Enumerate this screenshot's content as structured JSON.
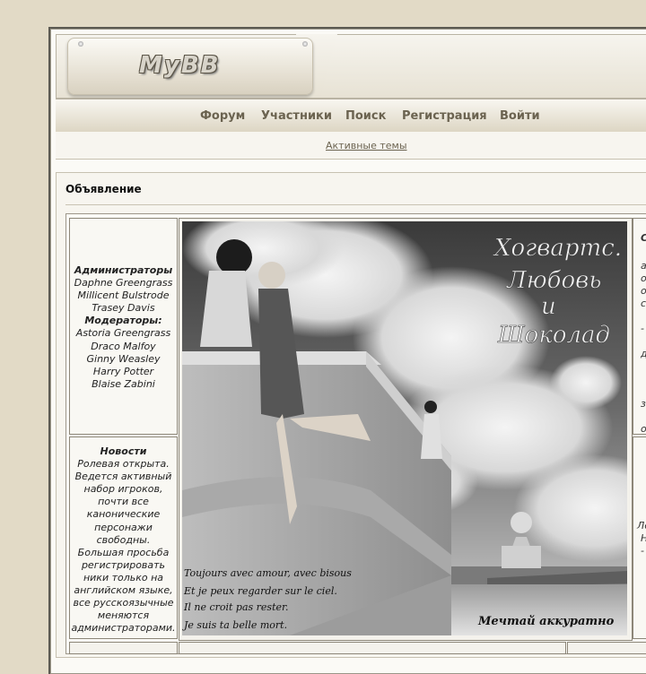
{
  "header": {
    "logo_text": "MyBB"
  },
  "nav": {
    "items": [
      "Форум",
      "Участники",
      "Поиск",
      "Регистрация",
      "Войти"
    ]
  },
  "subnav": {
    "active_topics": "Активные темы"
  },
  "announcement": {
    "title": "Объявление",
    "staff": {
      "admins_heading": "Администраторы",
      "admins": [
        "Daphne Greengrass",
        "Millicent Bulstrode",
        "Trasey Davis"
      ],
      "mods_heading": "Модераторы:",
      "mods": [
        "Astoria Greengrass",
        "Draco Malfoy",
        "Ginny Weasley",
        "Harry Potter",
        "Blaise Zabini"
      ]
    },
    "news": {
      "heading": "Новости",
      "lines": [
        "Ролевая открыта.",
        "Ведется активный",
        "набор игроков,",
        "почти все",
        "канонические",
        "персонажи",
        "свободны.",
        "Большая просьба",
        "регистрировать",
        "ники только на",
        "английском языке,",
        "все русскоязычные",
        "меняются",
        "администраторами."
      ]
    },
    "banner": {
      "title_lines": [
        "Хогвартс.",
        "Любовь",
        "и",
        "Шоколад"
      ],
      "poem_lines": [
        "Toujours avec amour, avec bisous",
        "Et je peux regarder sur le ciel.",
        "Il ne croit pas rester.",
        "Je suis ta belle mort."
      ],
      "signature": "Мечтай аккуратно"
    },
    "right_fragments": {
      "top": [
        "С",
        "а",
        "о",
        "о",
        "с",
        "-",
        "д",
        "з",
        "о"
      ],
      "bottom": [
        "Ле",
        "Н",
        "-"
      ]
    }
  }
}
